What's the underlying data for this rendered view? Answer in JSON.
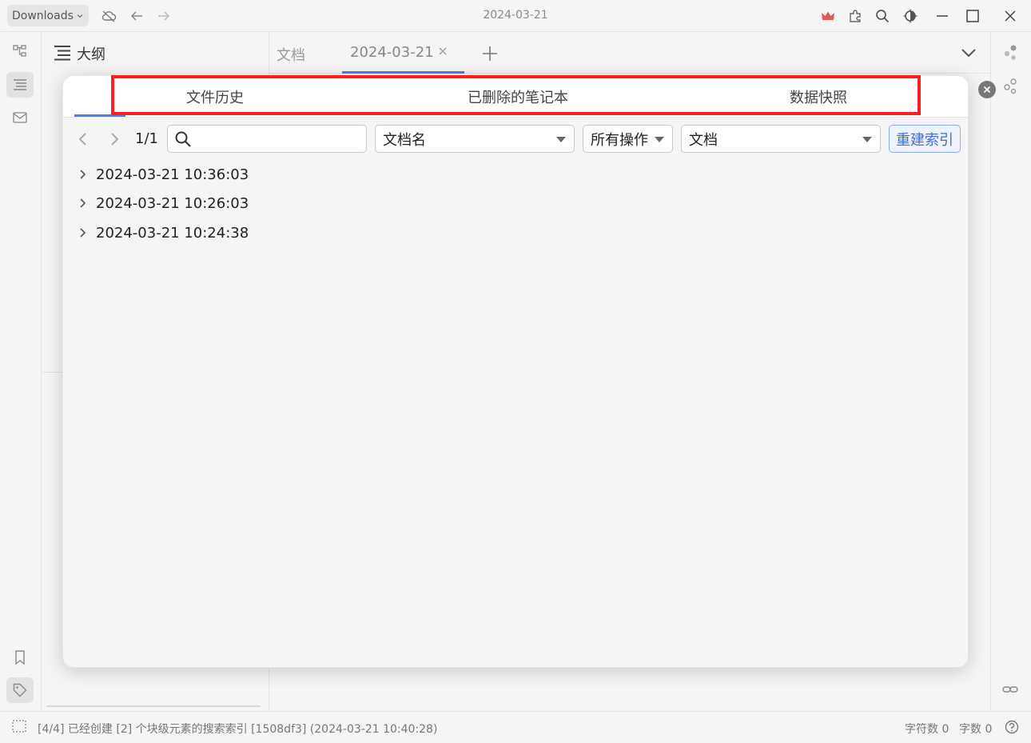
{
  "topbar": {
    "workspace": "Downloads",
    "title": "2024-03-21"
  },
  "outline": {
    "title": "大纲"
  },
  "tabs": [
    {
      "label": "文档"
    },
    {
      "label": "2024-03-21"
    }
  ],
  "dialog": {
    "tabs": [
      "文件历史",
      "已删除的笔记本",
      "数据快照"
    ],
    "pager": "1/1",
    "search": {
      "value": "",
      "placeholder": ""
    },
    "filter_name": "文档名",
    "filter_op": "所有操作",
    "filter_type": "文档",
    "rebuild_label": "重建索引",
    "entries": [
      "2024-03-21 10:36:03",
      "2024-03-21 10:26:03",
      "2024-03-21 10:24:38"
    ]
  },
  "status": {
    "message": "[4/4] 已经创建 [2] 个块级元素的搜索索引 [1508df3] (2024-03-21 10:40:28)",
    "char_count": "字符数 0",
    "word_count": "字数 0"
  },
  "colors": {
    "accent": "#4c7ee8",
    "highlight": "#ff1f1f",
    "crown": "#e05a5a"
  }
}
